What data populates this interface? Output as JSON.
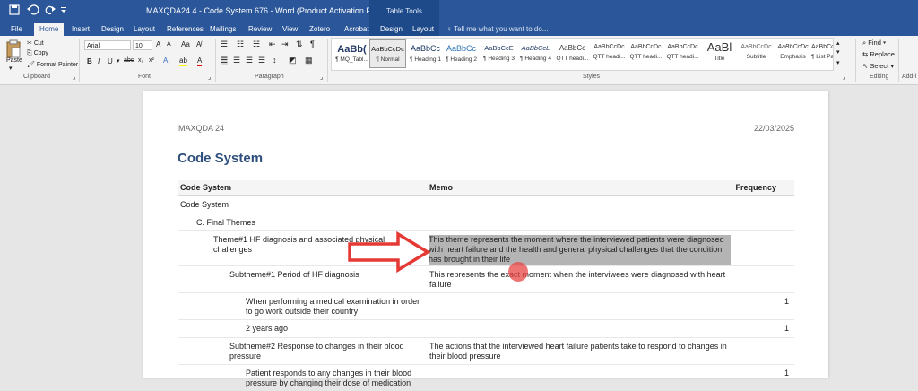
{
  "titlebar": {
    "save_icon": "save-icon",
    "undo_icon": "undo-icon",
    "redo_icon": "redo-icon",
    "document_title": "MAXQDA24 4 - Code System 676 - Word (Product Activation Failed)",
    "contextual_group": "Table Tools"
  },
  "tabs": [
    "File",
    "Home",
    "Insert",
    "Design",
    "Layout",
    "References",
    "Mailings",
    "Review",
    "View",
    "Zotero",
    "Acrobat",
    "Design",
    "Layout"
  ],
  "tell_me": "Tell me what you want to do...",
  "ribbon": {
    "clipboard": {
      "paste": "Paste",
      "cut": "Cut",
      "copy": "Copy",
      "format_painter": "Format Painter",
      "label": "Clipboard"
    },
    "font": {
      "name": "Arial",
      "size": "10",
      "label": "Font",
      "bold": "B",
      "italic": "I",
      "underline": "U",
      "grow": "A",
      "shrink": "A",
      "case": "Aa",
      "strike": "abc",
      "sub": "x₂",
      "sup": "x²",
      "effects": "A",
      "highlight": "ab",
      "color": "A"
    },
    "paragraph": {
      "label": "Paragraph"
    },
    "styles": {
      "label": "Styles",
      "items": [
        {
          "preview": "AaBb(",
          "name": "¶ MQ_Tabl..."
        },
        {
          "preview": "AaBbCcDc",
          "name": "¶ Normal"
        },
        {
          "preview": "AaBbCc",
          "name": "¶ Heading 1"
        },
        {
          "preview": "AaBbCc",
          "name": "¶ Heading 2"
        },
        {
          "preview": "AaBbCcE",
          "name": "¶ Heading 3"
        },
        {
          "preview": "AaBbCcL",
          "name": "¶ Heading 4"
        },
        {
          "preview": "AaBbCc",
          "name": "QTT headi..."
        },
        {
          "preview": "AaBbCcDc",
          "name": "QTT headi..."
        },
        {
          "preview": "AaBbCcDc",
          "name": "QTT headi..."
        },
        {
          "preview": "AaBbCcDc",
          "name": "QTT headi..."
        },
        {
          "preview": "AaBl",
          "name": "Title"
        },
        {
          "preview": "AaBbCcDc",
          "name": "Subtitle"
        },
        {
          "preview": "AaBbCcDc",
          "name": "Emphasis"
        },
        {
          "preview": "AaBbCcDc",
          "name": "¶ List Para..."
        }
      ]
    },
    "editing": {
      "find": "Find",
      "replace": "Replace",
      "select": "Select",
      "label": "Editing"
    },
    "addins_label": "Add-i"
  },
  "document": {
    "header_left": "MAXQDA 24",
    "header_right": "22/03/2025",
    "title": "Code System",
    "columns": [
      "Code System",
      "Memo",
      "Frequency"
    ],
    "rows": [
      {
        "indent": 0,
        "code": "Code System",
        "memo": "",
        "freq": ""
      },
      {
        "indent": 1,
        "code": "C. Final Themes",
        "memo": "",
        "freq": ""
      },
      {
        "indent": 2,
        "code": "Theme#1 HF diagnosis and associated physical challenges",
        "memo": "This theme represents the moment where the interviewed patients were diagnosed with heart failure and the health and general physical challenges that the condition has brought in their life",
        "freq": "",
        "highlight": true
      },
      {
        "indent": 3,
        "code": "Subtheme#1 Period of HF diagnosis",
        "memo": "This represents the exact moment when the interviwees were diagnosed with heart failure",
        "freq": ""
      },
      {
        "indent": 4,
        "code": "When performing a medical examination in order to go work outside their country",
        "memo": "",
        "freq": "1"
      },
      {
        "indent": 4,
        "code": "2 years ago",
        "memo": "",
        "freq": "1"
      },
      {
        "indent": 3,
        "code": "Subtheme#2 Response to changes in their blood pressure",
        "memo": "The actions that the interviewed heart failure patients take to respond to changes in their blood pressure",
        "freq": ""
      },
      {
        "indent": 4,
        "code": "Patient responds to any changes in their blood pressure by changing their dose of medication",
        "memo": "",
        "freq": "1"
      }
    ]
  },
  "annotation": {
    "arrow_color": "#e53935",
    "cursor_color": "#e84646"
  }
}
